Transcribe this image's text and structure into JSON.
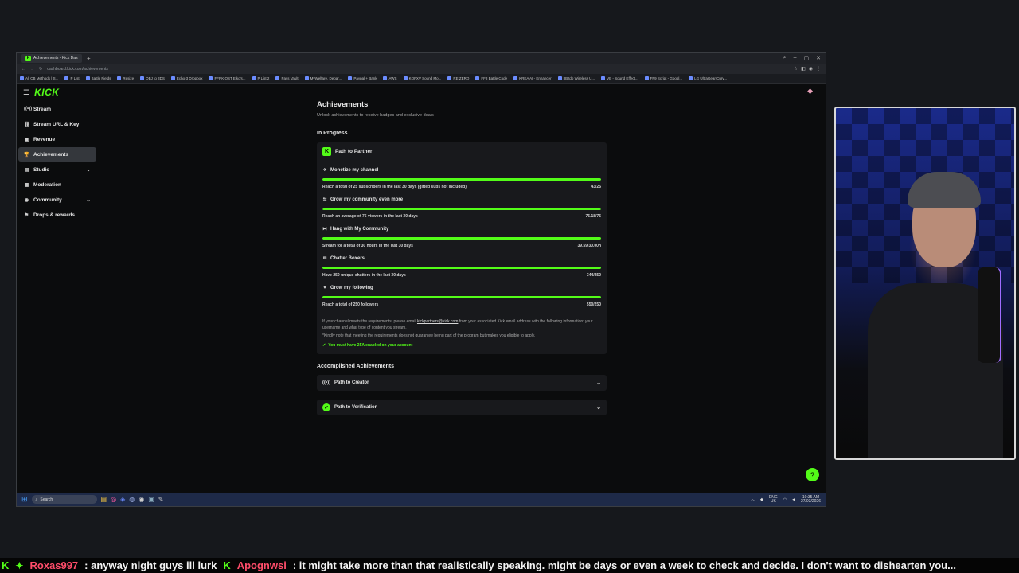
{
  "browser": {
    "tab_title": "Achievements - Kick Das",
    "new_tab": "+",
    "url": "dashboard.kick.com/achievements",
    "bookmarks": [
      "All CB Methods | S...",
      "P List",
      "Battle Fields",
      "Resize",
      "OBJ to 3DS",
      "Echo-3 Dropbox",
      "FFRK OST Eiko's...",
      "P List 2",
      "Pass Vault",
      "MyWelfare, Depar...",
      "Paypal + Bank",
      "AWS",
      "KOFXV Sound Mo...",
      "RE ZERO",
      "FF8 Battle Code",
      "KREA AI - Enhancer",
      "8Bitdo Wireless U...",
      "VB - Sound Effect...",
      "FF9 Script - Googl...",
      "LG UltraGear Curv..."
    ]
  },
  "sidebar": {
    "logo": "KICK",
    "items": [
      {
        "label": "Stream",
        "icon": "((•))"
      },
      {
        "label": "Stream URL & Key",
        "icon": "⛓"
      },
      {
        "label": "Revenue",
        "icon": "▣"
      },
      {
        "label": "Achievements",
        "icon": "🏆"
      },
      {
        "label": "Studio",
        "icon": "▤"
      },
      {
        "label": "Moderation",
        "icon": "▦"
      },
      {
        "label": "Community",
        "icon": "◉"
      },
      {
        "label": "Drops & rewards",
        "icon": "⚑"
      }
    ],
    "chevron": "⌄"
  },
  "main": {
    "title": "Achievements",
    "subtitle": "Unlock achievements to receive badges and exclusive deals",
    "in_progress_label": "In Progress",
    "card_title": "Path to Partner",
    "achievements": [
      {
        "title": "Monetize my channel",
        "desc": "Reach a total of 25 subscribers in the last 30 days (gifted subs not included)",
        "value": "43/25",
        "progress": 1.0
      },
      {
        "title": "Grow my community even more",
        "desc": "Reach an average of 75 viewers in the last 30 days",
        "value": "75.18/75",
        "progress": 1.0
      },
      {
        "title": "Hang with My Community",
        "desc": "Stream for a total of 30 hours in the last 30 days",
        "value": "39.59/30.00h",
        "progress": 1.0
      },
      {
        "title": "Chatter Boxers",
        "desc": "Have 250 unique chatters in the last 30 days",
        "value": "344/250",
        "progress": 1.0
      },
      {
        "title": "Grow my following",
        "desc": "Reach a total of 250 followers",
        "value": "550/250",
        "progress": 1.0
      }
    ],
    "note_pre": "If your channel meets the requirements, please email ",
    "note_email": "kickpartners@kick.com",
    "note_post": " from your associated Kick email address with the following information: your username and what type of content you stream.",
    "note2": "*Kindly note that meeting the requirements does not guarantee being part of the program but makes you eligible to apply.",
    "requirement": "You must have 2FA enabled on your account",
    "accomplished_label": "Accomplished Achievements",
    "accomplished": [
      {
        "label": "Path to Creator"
      },
      {
        "label": "Path to Verification"
      }
    ]
  },
  "taskbar": {
    "search": "Search",
    "lang_top": "ENG",
    "lang_bottom": "UK",
    "time": "10:35 AM",
    "date": "27/03/2026"
  },
  "chat": [
    {
      "user": "Roxas997",
      "message": ": anyway night guys ill lurk"
    },
    {
      "user": "Apognwsi",
      "message": ": it might take more than that realistically speaking. might be days or even a week to check and decide. I don't want to dishearten you..."
    }
  ],
  "colors": {
    "accent": "#53fc18",
    "chat_user": "#ff4d6a"
  }
}
